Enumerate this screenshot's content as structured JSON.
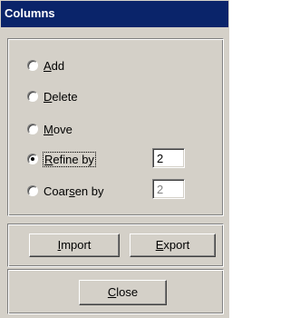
{
  "window": {
    "title": "Columns"
  },
  "options": [
    {
      "pre": "",
      "mnemonic": "A",
      "post": "dd",
      "checked": false
    },
    {
      "pre": "",
      "mnemonic": "D",
      "post": "elete",
      "checked": false
    },
    {
      "pre": "",
      "mnemonic": "M",
      "post": "ove",
      "checked": false
    },
    {
      "pre": "",
      "mnemonic": "R",
      "post": "efine by",
      "checked": true
    },
    {
      "pre": "Coar",
      "mnemonic": "s",
      "post": "en by",
      "checked": false
    }
  ],
  "fields": {
    "refine_value": "2",
    "coarsen_value": "2"
  },
  "buttons": {
    "import": {
      "pre": "",
      "mnemonic": "I",
      "post": "mport"
    },
    "export": {
      "pre": "",
      "mnemonic": "E",
      "post": "xport"
    },
    "close": {
      "pre": "",
      "mnemonic": "C",
      "post": "lose"
    }
  },
  "colors": {
    "title_bar": "#0a246a",
    "face": "#d4d0c8",
    "disabled_text": "#808080"
  }
}
